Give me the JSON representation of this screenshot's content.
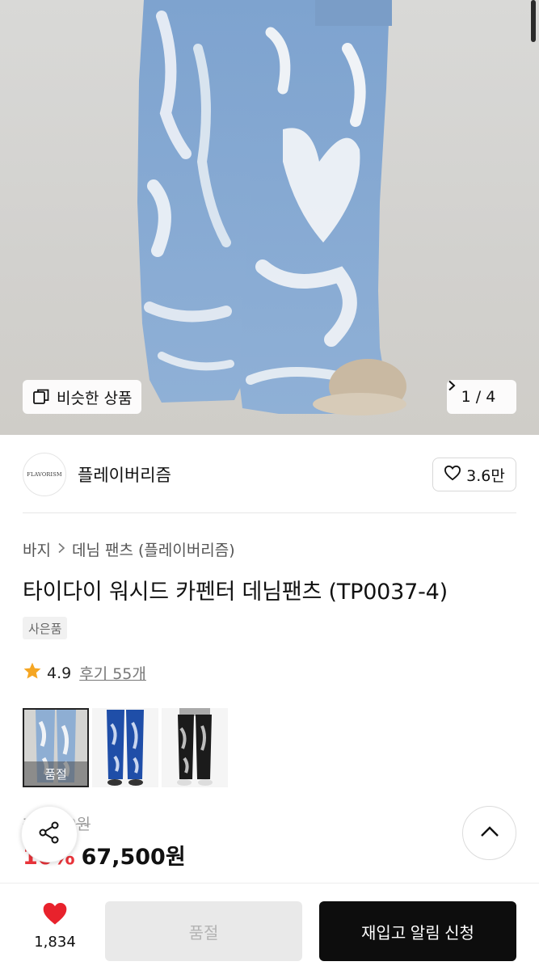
{
  "hero": {
    "similar_label": "비슷한 상품",
    "page_indicator": "1 / 4"
  },
  "brand": {
    "logo_text": "FLAVORISM",
    "name": "플레이버리즘",
    "like_count": "3.6만"
  },
  "breadcrumb": {
    "items": [
      "바지",
      "데님 팬츠 (플레이버리즘)"
    ]
  },
  "product": {
    "title": "타이다이 워시드 카펜터 데님팬츠 (TP0037-4)",
    "badge": "사은품",
    "rating": "4.9",
    "review_label": "후기 55개",
    "thumbnails": [
      {
        "variant": "light-blue",
        "selected": true,
        "status": "품절"
      },
      {
        "variant": "dark-blue",
        "selected": false,
        "status": ""
      },
      {
        "variant": "black",
        "selected": false,
        "status": ""
      }
    ],
    "original_price": "75,000원",
    "discount": "10%",
    "price": "67,500원"
  },
  "bottom_bar": {
    "wish_count": "1,834",
    "soldout_label": "품절",
    "restock_label": "재입고 알림 신청"
  },
  "colors": {
    "accent_red": "#e8333a",
    "primary_black": "#0d0d0d",
    "heart_red": "#e8222c"
  }
}
